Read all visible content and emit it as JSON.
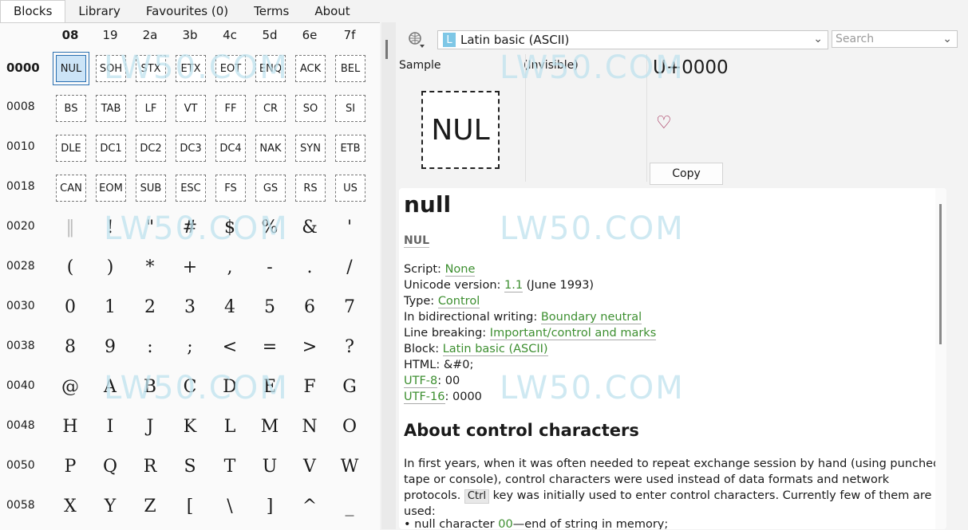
{
  "tabs": [
    {
      "label": "Blocks",
      "active": true
    },
    {
      "label": "Library"
    },
    {
      "label": "Favourites (0)"
    },
    {
      "label": "Terms"
    },
    {
      "label": "About"
    }
  ],
  "grid": {
    "col_headers": [
      "08",
      "19",
      "2a",
      "3b",
      "4c",
      "5d",
      "6e",
      "7f"
    ],
    "rows": [
      {
        "label": "0000",
        "cells": [
          "NUL",
          "SOH",
          "STX",
          "ETX",
          "EOT",
          "ENQ",
          "ACK",
          "BEL"
        ],
        "kind": "ctrl"
      },
      {
        "label": "0008",
        "cells": [
          "BS",
          "TAB",
          "LF",
          "VT",
          "FF",
          "CR",
          "SO",
          "SI"
        ],
        "kind": "ctrl"
      },
      {
        "label": "0010",
        "cells": [
          "DLE",
          "DC1",
          "DC2",
          "DC3",
          "DC4",
          "NAK",
          "SYN",
          "ETB"
        ],
        "kind": "ctrl"
      },
      {
        "label": "0018",
        "cells": [
          "CAN",
          "EOM",
          "SUB",
          "ESC",
          "FS",
          "GS",
          "RS",
          "US"
        ],
        "kind": "ctrl"
      },
      {
        "label": "0020",
        "cells": [
          "‖",
          "!",
          "\"",
          "#",
          "$",
          "%",
          "&",
          "'"
        ],
        "kind": "glyph"
      },
      {
        "label": "0028",
        "cells": [
          "(",
          ")",
          "*",
          "+",
          ",",
          "-",
          ".",
          "/"
        ],
        "kind": "glyph"
      },
      {
        "label": "0030",
        "cells": [
          "0",
          "1",
          "2",
          "3",
          "4",
          "5",
          "6",
          "7"
        ],
        "kind": "glyph"
      },
      {
        "label": "0038",
        "cells": [
          "8",
          "9",
          ":",
          ";",
          "<",
          "=",
          ">",
          "?"
        ],
        "kind": "glyph"
      },
      {
        "label": "0040",
        "cells": [
          "@",
          "A",
          "B",
          "C",
          "D",
          "E",
          "F",
          "G"
        ],
        "kind": "glyph"
      },
      {
        "label": "0048",
        "cells": [
          "H",
          "I",
          "J",
          "K",
          "L",
          "M",
          "N",
          "O"
        ],
        "kind": "glyph"
      },
      {
        "label": "0050",
        "cells": [
          "P",
          "Q",
          "R",
          "S",
          "T",
          "U",
          "V",
          "W"
        ],
        "kind": "glyph"
      },
      {
        "label": "0058",
        "cells": [
          "X",
          "Y",
          "Z",
          "[",
          "\\",
          "]",
          "^",
          "_"
        ],
        "kind": "glyph"
      }
    ]
  },
  "toolbar": {
    "block_badge": "L",
    "block_name": "Latin basic (ASCII)",
    "search_placeholder": "Search",
    "dropdown_icon": "chevron-down-icon",
    "tool_icon": "font-settings-icon"
  },
  "detail": {
    "sample_label": "Sample",
    "invisible_label": "(Invisible)",
    "sample_glyph": "NUL",
    "codepoint": "U+0000",
    "favourite_glyph": "♡",
    "copy_label": "Copy"
  },
  "info": {
    "name": "null",
    "alias": "NUL",
    "props": {
      "script_label": "Script: ",
      "script_value": "None",
      "version_label": "Unicode version: ",
      "version_value": "1.1",
      "version_note": " (June 1993)",
      "type_label": "Type: ",
      "type_value": "Control",
      "bidi_label": "In bidirectional writing: ",
      "bidi_value": "Boundary neutral",
      "lb_label": "Line breaking: ",
      "lb_value": "Important/control and marks",
      "block_label": "Block: ",
      "block_value": "Latin basic (ASCII)",
      "html_label": "HTML: ",
      "html_value": "&#0;",
      "utf8_label": "UTF-8",
      "utf8_value": ": 00",
      "utf16_label": "UTF-16",
      "utf16_value": ": 0000"
    },
    "about_title": "About control characters",
    "para_1": "In first years, when it was often needed to repeat exchange session by hand (using punched tape or console), control characters were used instead of data formats and network protocols.",
    "kbd": "Ctrl",
    "para_2": " key was initially used to enter control characters. Currently few of them are used:",
    "bullet_text": "• null character ",
    "bullet_link": "00",
    "bullet_rest": "—end of string in memory;"
  },
  "colors": {
    "accent_link": "#3d8f30",
    "selection": "#cce4f7",
    "heart": "#a0234f",
    "badge": "#7ec7e6"
  },
  "watermark": "LW50.COM"
}
